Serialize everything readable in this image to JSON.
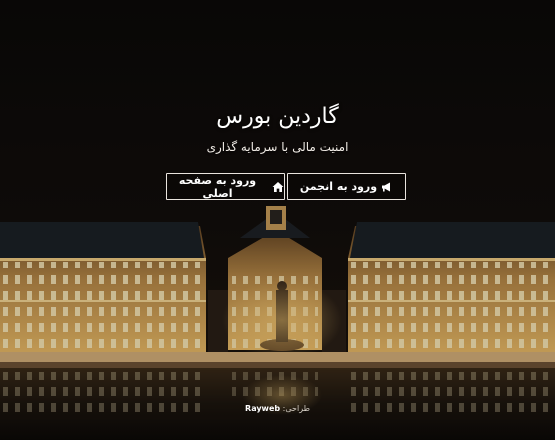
{
  "hero": {
    "title": "گاردین بورس",
    "subtitle": "امنیت مالی با سرمایه گذاری"
  },
  "buttons": {
    "forum": {
      "label": "ورود به انجمن",
      "icon": "megaphone-icon"
    },
    "home": {
      "label": "ورود به صفحه اصلی",
      "icon": "home-icon"
    }
  },
  "footer": {
    "prefix": "طراحی:",
    "brand": "Rayweb"
  },
  "colors": {
    "background": "#0d0a08",
    "building_lit": "#e8b761",
    "button_border": "#e9e4de"
  }
}
